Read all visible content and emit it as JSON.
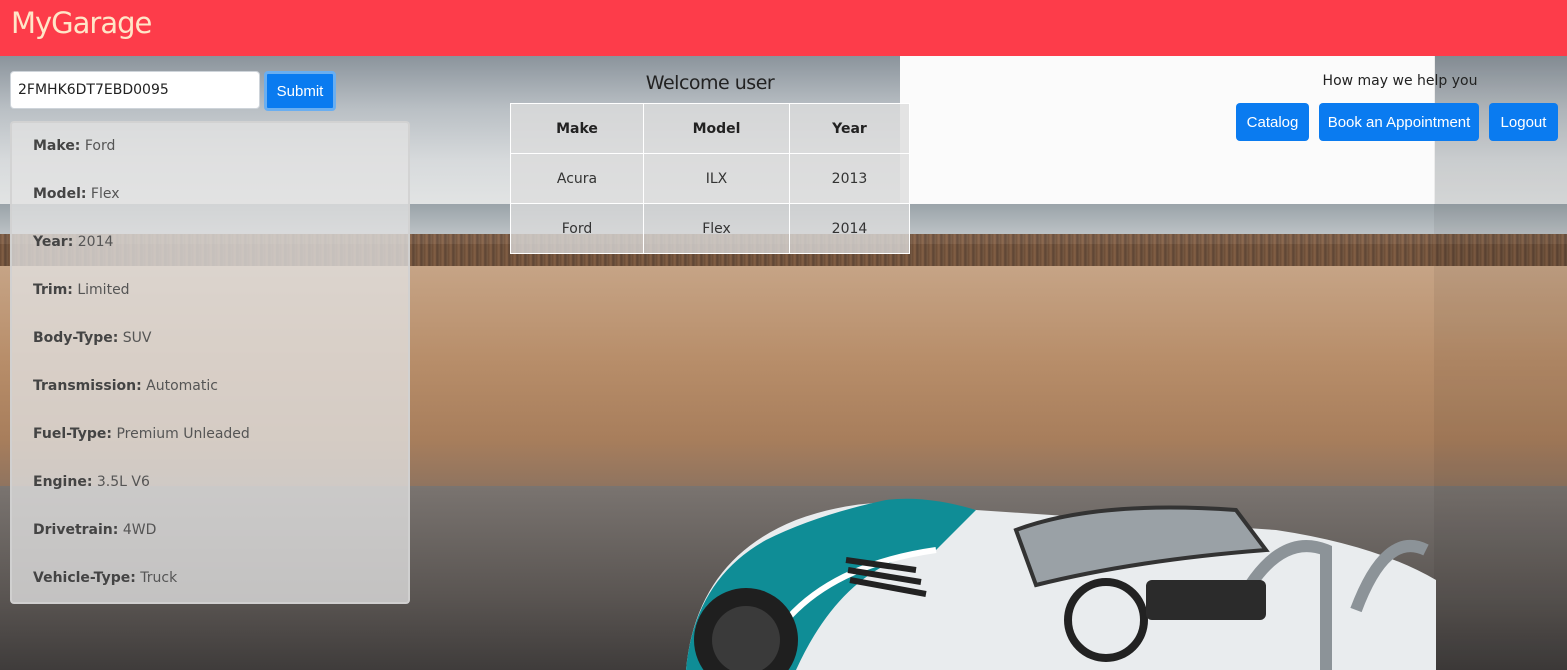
{
  "app": {
    "brand": "MyGarage"
  },
  "vin_form": {
    "value": "2FMHK6DT7EBD0095",
    "submit_label": "Submit"
  },
  "details": [
    {
      "label": "Make:",
      "value": "Ford"
    },
    {
      "label": "Model:",
      "value": "Flex"
    },
    {
      "label": "Year:",
      "value": "2014"
    },
    {
      "label": "Trim:",
      "value": "Limited"
    },
    {
      "label": "Body-Type:",
      "value": "SUV"
    },
    {
      "label": "Transmission:",
      "value": "Automatic"
    },
    {
      "label": "Fuel-Type:",
      "value": "Premium Unleaded"
    },
    {
      "label": "Engine:",
      "value": "3.5L V6"
    },
    {
      "label": "Drivetrain:",
      "value": "4WD"
    },
    {
      "label": "Vehicle-Type:",
      "value": "Truck"
    }
  ],
  "welcome": "Welcome user",
  "cars_table": {
    "headers": [
      "Make",
      "Model",
      "Year"
    ],
    "rows": [
      [
        "Acura",
        "ILX",
        "2013"
      ],
      [
        "Ford",
        "Flex",
        "2014"
      ]
    ]
  },
  "help_text": "How may we help you",
  "nav": {
    "catalog": "Catalog",
    "book": "Book an Appointment",
    "logout": "Logout"
  },
  "colors": {
    "navbar": "#fd3c4a",
    "primary": "#0a7bf0",
    "brand_text": "#ffe6c8"
  },
  "background_image": "beach-roadster-car"
}
